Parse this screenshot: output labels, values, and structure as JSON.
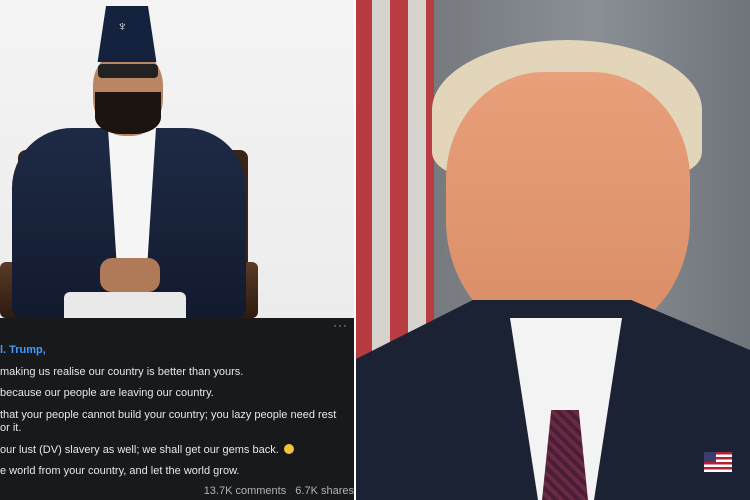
{
  "post": {
    "lines": [
      "l. Trump,",
      "making us realise our country is better than yours.",
      "because our people are leaving our country.",
      "that your people cannot build your country; you lazy people need rest",
      "or it.",
      "our lust (DV) slavery as well; we shall get our gems back.",
      "e world from your country, and let the world grow."
    ],
    "more_menu": "···",
    "emoji": "slightly-smiling-face",
    "stats": {
      "comments": "13.7K comments",
      "shares": "6.7K shares"
    }
  },
  "colors": {
    "post_background": "#18191a",
    "post_text": "#e4e6eb",
    "name_link": "#4599ff",
    "meta_text": "#b0b3b8"
  },
  "icons": {
    "cap_badge": "kukri-emblem",
    "lapel_pin": "us-flag-pin"
  }
}
